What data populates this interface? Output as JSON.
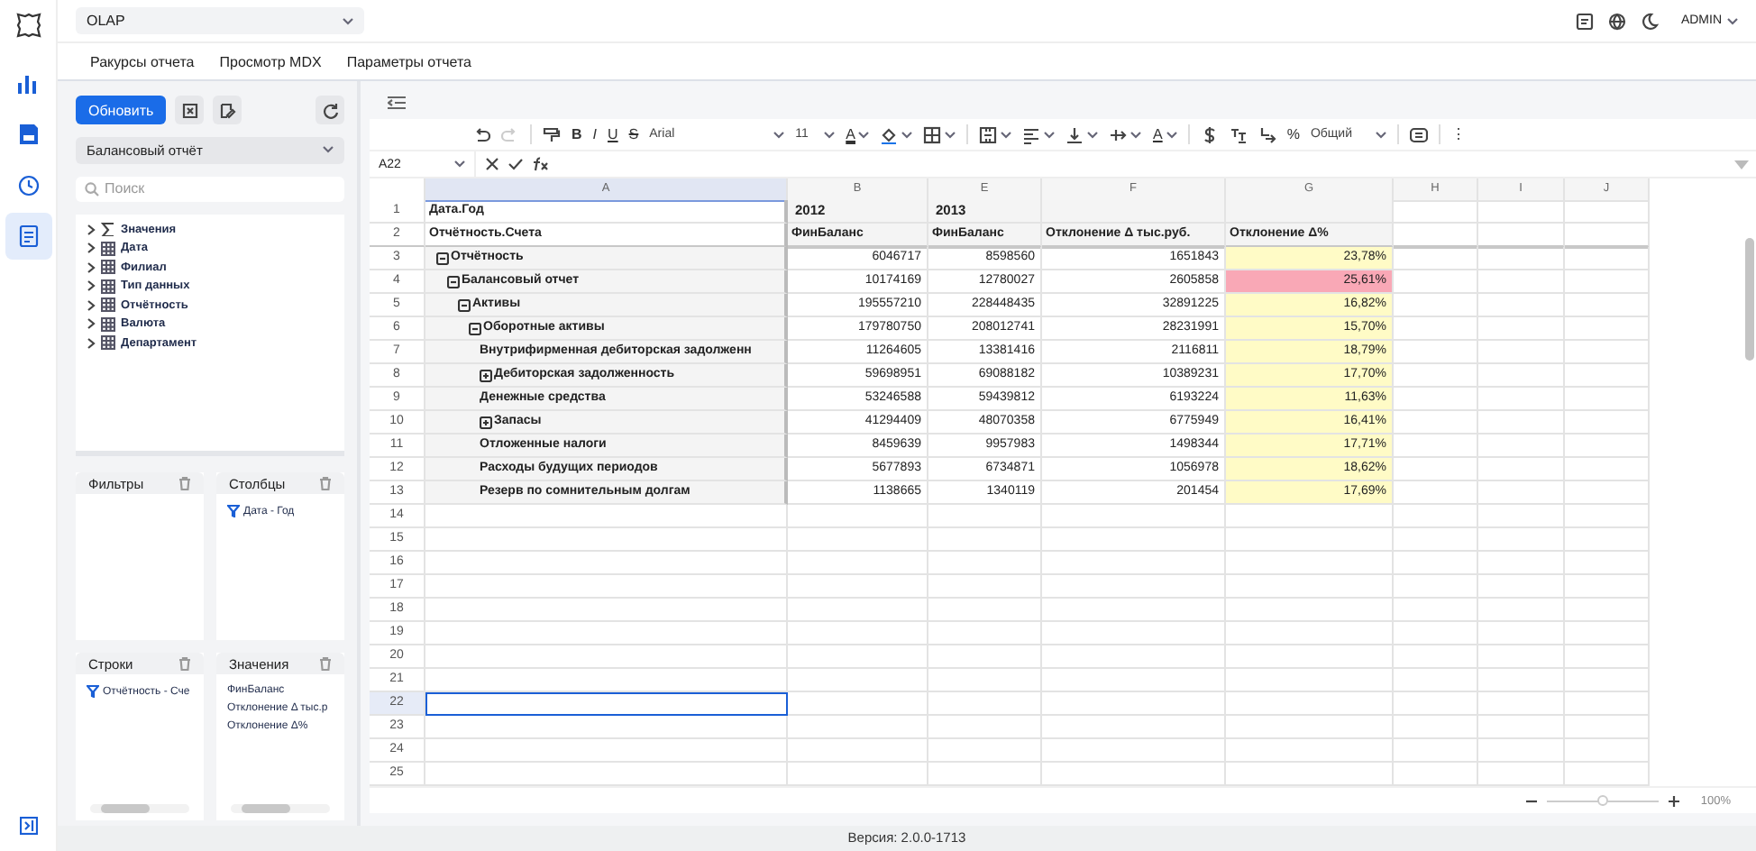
{
  "topbar": {
    "module": "OLAP",
    "user": "ADMIN"
  },
  "rail": [
    {
      "selected": false
    },
    {
      "selected": false
    },
    {
      "selected": false
    },
    {
      "selected": true
    }
  ],
  "tabs": [
    {
      "label": "Ракурсы отчета",
      "selected": false
    },
    {
      "label": "Просмотр MDX",
      "selected": false
    },
    {
      "label": "Параметры отчета",
      "selected": false
    }
  ],
  "panel": {
    "refresh_button": "Обновить",
    "report": "Балансовый отчёт",
    "search_placeholder": "Поиск",
    "fields": [
      {
        "label": "Значения",
        "kind": "measures"
      },
      {
        "label": "Дата",
        "kind": "dimension"
      },
      {
        "label": "Филиал",
        "kind": "dimension"
      },
      {
        "label": "Тип данных",
        "kind": "dimension"
      },
      {
        "label": "Отчётность",
        "kind": "dimension"
      },
      {
        "label": "Валюта",
        "kind": "dimension"
      },
      {
        "label": "Департамент",
        "kind": "dimension"
      }
    ],
    "zones": [
      {
        "title": "Фильтры",
        "scrollbar": false
      },
      {
        "title": "Столбцы",
        "items": [
          {
            "label": "Дата - Год",
            "filtered": true
          }
        ],
        "scrollbar": false
      },
      {
        "title": "Строки",
        "items": [
          {
            "label": "Отчётность - Сче",
            "filtered": true
          }
        ],
        "scrollbar": true
      },
      {
        "title": "Значения",
        "items": [
          {
            "label": "ФинБаланс",
            "filtered": false
          },
          {
            "label": "Отклонение Δ тыс.р",
            "filtered": false
          },
          {
            "label": "Отклонение Δ%",
            "filtered": false
          }
        ],
        "scrollbar": true
      }
    ]
  },
  "toolbar": [
    {
      "kind": "undo"
    },
    {
      "kind": "redo"
    },
    {
      "kind": "sep"
    },
    {
      "kind": "paint"
    },
    {
      "kind": "bold",
      "label": "B"
    },
    {
      "kind": "italic",
      "label": "I"
    },
    {
      "kind": "underline",
      "label": "U"
    },
    {
      "kind": "strike",
      "label": "S"
    },
    {
      "kind": "font",
      "label": "Arial"
    },
    {
      "kind": "size",
      "label": "11"
    },
    {
      "kind": "text-color",
      "label": "A"
    },
    {
      "kind": "fill"
    },
    {
      "kind": "borders"
    },
    {
      "kind": "sep"
    },
    {
      "kind": "merge"
    },
    {
      "kind": "align"
    },
    {
      "kind": "valign"
    },
    {
      "kind": "wrap"
    },
    {
      "kind": "rotate",
      "label": "A"
    },
    {
      "kind": "sep"
    },
    {
      "kind": "currency"
    },
    {
      "kind": "dec-more"
    },
    {
      "kind": "dec-less"
    },
    {
      "kind": "percent",
      "label": "%"
    },
    {
      "kind": "format",
      "label": "Общий"
    },
    {
      "kind": "sep"
    },
    {
      "kind": "comment"
    },
    {
      "kind": "sep"
    },
    {
      "kind": "more",
      "label": "⋮"
    }
  ],
  "sheet": {
    "cell_ref": "A22",
    "columns": [
      {
        "label": "A",
        "selected": true
      },
      {
        "label": "B",
        "selected": false
      },
      {
        "label": "E",
        "selected": false
      },
      {
        "label": "F",
        "selected": false
      },
      {
        "label": "G",
        "selected": false
      },
      {
        "label": "H",
        "selected": false
      },
      {
        "label": "I",
        "selected": false
      },
      {
        "label": "J",
        "selected": false
      }
    ],
    "header_rows": [
      {
        "row": "1",
        "label": "Дата.Год",
        "cells": [
          "2012",
          "2013"
        ]
      },
      {
        "row": "2",
        "label": "Отчётность.Счета",
        "cells": [
          "ФинБаланс",
          "ФинБаланс",
          "Отклонение Δ тыс.руб.",
          "Отклонение Δ%"
        ]
      }
    ],
    "rows": [
      {
        "row": "3",
        "label": "Отчётность",
        "expanded": true,
        "values": [
          "6046717",
          "8598560",
          "1651843",
          "23,78%"
        ],
        "color": "#fffbc6",
        "children": [
          {
            "row": "4",
            "label": "Балансовый отчет",
            "expanded": true,
            "values": [
              "10174169",
              "12780027",
              "2605858",
              "25,61%"
            ],
            "color": "#f9a8b6",
            "children": [
              {
                "row": "5",
                "label": "Активы",
                "expanded": true,
                "values": [
                  "195557210",
                  "228448435",
                  "32891225",
                  "16,82%"
                ],
                "color": "#fffbc6",
                "children": [
                  {
                    "row": "6",
                    "label": "Оборотные активы",
                    "expanded": true,
                    "values": [
                      "179780750",
                      "208012741",
                      "28231991",
                      "15,70%"
                    ],
                    "color": "#fffbc6",
                    "children": [
                      {
                        "row": "7",
                        "label": "Внутрифирменная дебиторская задолженн",
                        "values": [
                          "11264605",
                          "13381416",
                          "2116811",
                          "18,79%"
                        ],
                        "color": "#fffbc6"
                      },
                      {
                        "row": "8",
                        "label": "Дебиторская задолженность",
                        "expanded": false,
                        "values": [
                          "59698951",
                          "69088182",
                          "10389231",
                          "17,70%"
                        ],
                        "color": "#fffbc6"
                      },
                      {
                        "row": "9",
                        "label": "Денежные средства",
                        "values": [
                          "53246588",
                          "59439812",
                          "6193224",
                          "11,63%"
                        ],
                        "color": "#fffbc6"
                      },
                      {
                        "row": "10",
                        "label": "Запасы",
                        "expanded": false,
                        "values": [
                          "41294409",
                          "48070358",
                          "6775949",
                          "16,41%"
                        ],
                        "color": "#fffbc6"
                      },
                      {
                        "row": "11",
                        "label": "Отложенные налоги",
                        "values": [
                          "8459639",
                          "9957983",
                          "1498344",
                          "17,71%"
                        ],
                        "color": "#fffbc6"
                      },
                      {
                        "row": "12",
                        "label": "Расходы будущих периодов",
                        "values": [
                          "5677893",
                          "6734871",
                          "1056978",
                          "18,62%"
                        ],
                        "color": "#fffbc6"
                      },
                      {
                        "row": "13",
                        "label": "Резерв по сомнительным долгам",
                        "values": [
                          "1138665",
                          "1340119",
                          "201454",
                          "17,69%"
                        ],
                        "color": "#fffbc6"
                      }
                    ]
                  }
                ]
              }
            ]
          }
        ]
      }
    ],
    "empty_rows": [
      {
        "row": "14",
        "selected": false
      },
      {
        "row": "15",
        "selected": false
      },
      {
        "row": "16",
        "selected": false
      },
      {
        "row": "17",
        "selected": false
      },
      {
        "row": "18",
        "selected": false
      },
      {
        "row": "19",
        "selected": false
      },
      {
        "row": "20",
        "selected": false
      },
      {
        "row": "21",
        "selected": false
      },
      {
        "row": "22",
        "selected": true
      },
      {
        "row": "23",
        "selected": false
      },
      {
        "row": "24",
        "selected": false
      },
      {
        "row": "25",
        "selected": false
      }
    ]
  },
  "zoom": {
    "level": 0.5,
    "reading": "100%"
  },
  "footer": "Версия: 2.0.0-1713"
}
